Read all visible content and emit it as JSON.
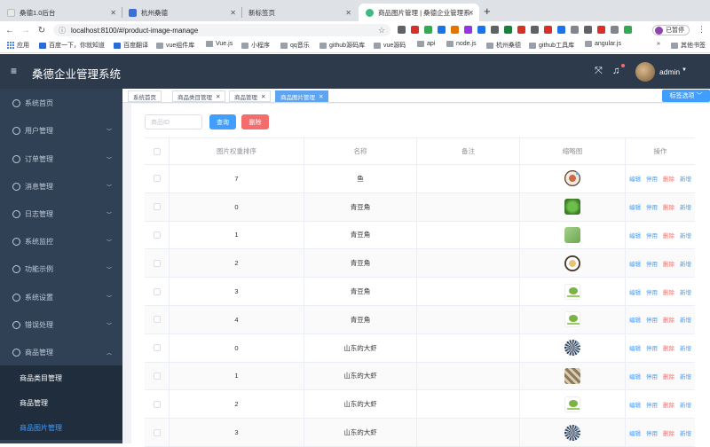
{
  "browser": {
    "tabs": [
      {
        "title": "桑德1.0后台"
      },
      {
        "title": "杭州桑德"
      },
      {
        "title": "新标签页"
      },
      {
        "title": "商品图片管理 | 桑德企业管理系…"
      }
    ],
    "url": "localhost:8100/#/product-image-manage",
    "profile_label": "已暂停",
    "bookmarks": [
      "应用",
      "百度一下，你就知道",
      "百度翻译",
      "vue组件库",
      "Vue.js",
      "小程序",
      "qq音乐",
      "github源码库",
      "vue源码",
      "api",
      "node.js",
      "杭州桑德",
      "github工具库",
      "angular.js",
      "»",
      "其他书签"
    ]
  },
  "app": {
    "title": "桑德企业管理系统",
    "username": "admin"
  },
  "sidebar": {
    "items": [
      {
        "label": "系统首页"
      },
      {
        "label": "用户管理"
      },
      {
        "label": "订单管理"
      },
      {
        "label": "消息管理"
      },
      {
        "label": "日志管理"
      },
      {
        "label": "系统监控"
      },
      {
        "label": "功能示例"
      },
      {
        "label": "系统设置"
      },
      {
        "label": "错误处理"
      },
      {
        "label": "商品管理"
      }
    ],
    "submenu": [
      {
        "label": "商品类目管理"
      },
      {
        "label": "商品管理"
      },
      {
        "label": "商品图片管理"
      }
    ]
  },
  "tags": [
    {
      "label": "系统首页"
    },
    {
      "label": "商品类目管理"
    },
    {
      "label": "商品管理"
    },
    {
      "label": "商品图片管理"
    }
  ],
  "tags_button": "标签选项",
  "toolbar": {
    "search_placeholder": "商品ID",
    "query_label": "查询",
    "delete_label": "删除"
  },
  "table": {
    "headers": [
      "图片权重排序",
      "名称",
      "备注",
      "缩略图",
      "操作"
    ],
    "ops": [
      "编辑",
      "停用",
      "删除",
      "新增"
    ],
    "rows": [
      {
        "weight": "7",
        "name": "鱼",
        "note": "",
        "thumb": "plate"
      },
      {
        "weight": "0",
        "name": "青豆角",
        "note": "",
        "thumb": "greens"
      },
      {
        "weight": "1",
        "name": "青豆角",
        "note": "",
        "thumb": "leaf"
      },
      {
        "weight": "2",
        "name": "青豆角",
        "note": "",
        "thumb": "dish"
      },
      {
        "weight": "3",
        "name": "青豆角",
        "note": "",
        "thumb": "logo"
      },
      {
        "weight": "4",
        "name": "青豆角",
        "note": "",
        "thumb": "logo"
      },
      {
        "weight": "0",
        "name": "山东的大虾",
        "note": "",
        "thumb": "fan"
      },
      {
        "weight": "1",
        "name": "山东的大虾",
        "note": "",
        "thumb": "grid"
      },
      {
        "weight": "2",
        "name": "山东的大虾",
        "note": "",
        "thumb": "logo"
      },
      {
        "weight": "3",
        "name": "山东的大虾",
        "note": "",
        "thumb": "fan"
      }
    ]
  },
  "colors": {
    "header_bg": "#2d3a4b",
    "sidebar_bg": "#304156",
    "primary": "#409eff",
    "danger": "#f56c6c"
  }
}
